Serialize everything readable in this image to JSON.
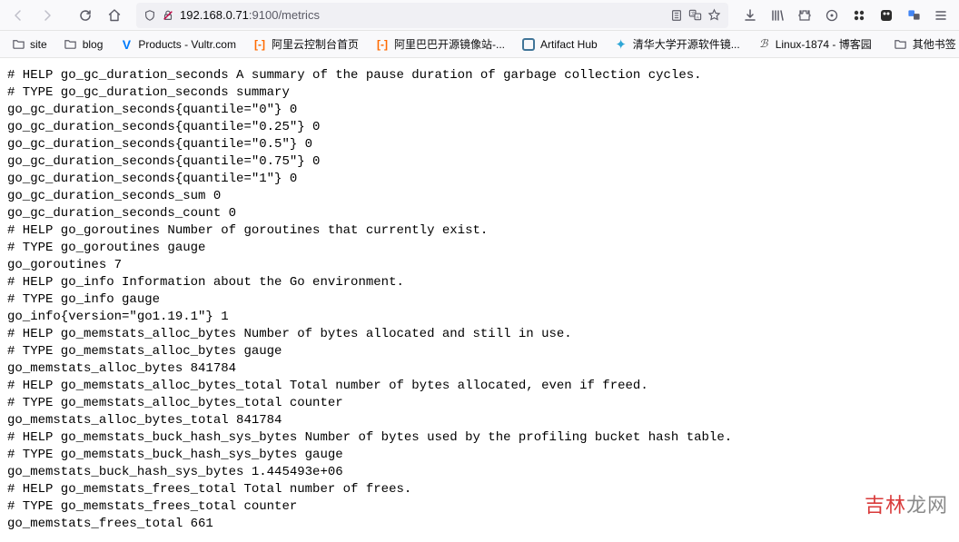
{
  "url": {
    "prefix": "192.168.0.71",
    "suffix": ":9100/metrics"
  },
  "bookmarks": {
    "site": "site",
    "blog": "blog",
    "vultr": "Products - Vultr.com",
    "aliyun_console": "阿里云控制台首页",
    "aliyun_mirror": "阿里巴巴开源镜像站-...",
    "artifact": "Artifact Hub",
    "tsinghua": "清华大学开源软件镜...",
    "linux": "Linux-1874 - 博客园",
    "other": "其他书签"
  },
  "metrics": [
    "# HELP go_gc_duration_seconds A summary of the pause duration of garbage collection cycles.",
    "# TYPE go_gc_duration_seconds summary",
    "go_gc_duration_seconds{quantile=\"0\"} 0",
    "go_gc_duration_seconds{quantile=\"0.25\"} 0",
    "go_gc_duration_seconds{quantile=\"0.5\"} 0",
    "go_gc_duration_seconds{quantile=\"0.75\"} 0",
    "go_gc_duration_seconds{quantile=\"1\"} 0",
    "go_gc_duration_seconds_sum 0",
    "go_gc_duration_seconds_count 0",
    "# HELP go_goroutines Number of goroutines that currently exist.",
    "# TYPE go_goroutines gauge",
    "go_goroutines 7",
    "# HELP go_info Information about the Go environment.",
    "# TYPE go_info gauge",
    "go_info{version=\"go1.19.1\"} 1",
    "# HELP go_memstats_alloc_bytes Number of bytes allocated and still in use.",
    "# TYPE go_memstats_alloc_bytes gauge",
    "go_memstats_alloc_bytes 841784",
    "# HELP go_memstats_alloc_bytes_total Total number of bytes allocated, even if freed.",
    "# TYPE go_memstats_alloc_bytes_total counter",
    "go_memstats_alloc_bytes_total 841784",
    "# HELP go_memstats_buck_hash_sys_bytes Number of bytes used by the profiling bucket hash table.",
    "# TYPE go_memstats_buck_hash_sys_bytes gauge",
    "go_memstats_buck_hash_sys_bytes 1.445493e+06",
    "# HELP go_memstats_frees_total Total number of frees.",
    "# TYPE go_memstats_frees_total counter",
    "go_memstats_frees_total 661"
  ],
  "watermark": {
    "red": "吉林",
    "gray": "龙网"
  }
}
